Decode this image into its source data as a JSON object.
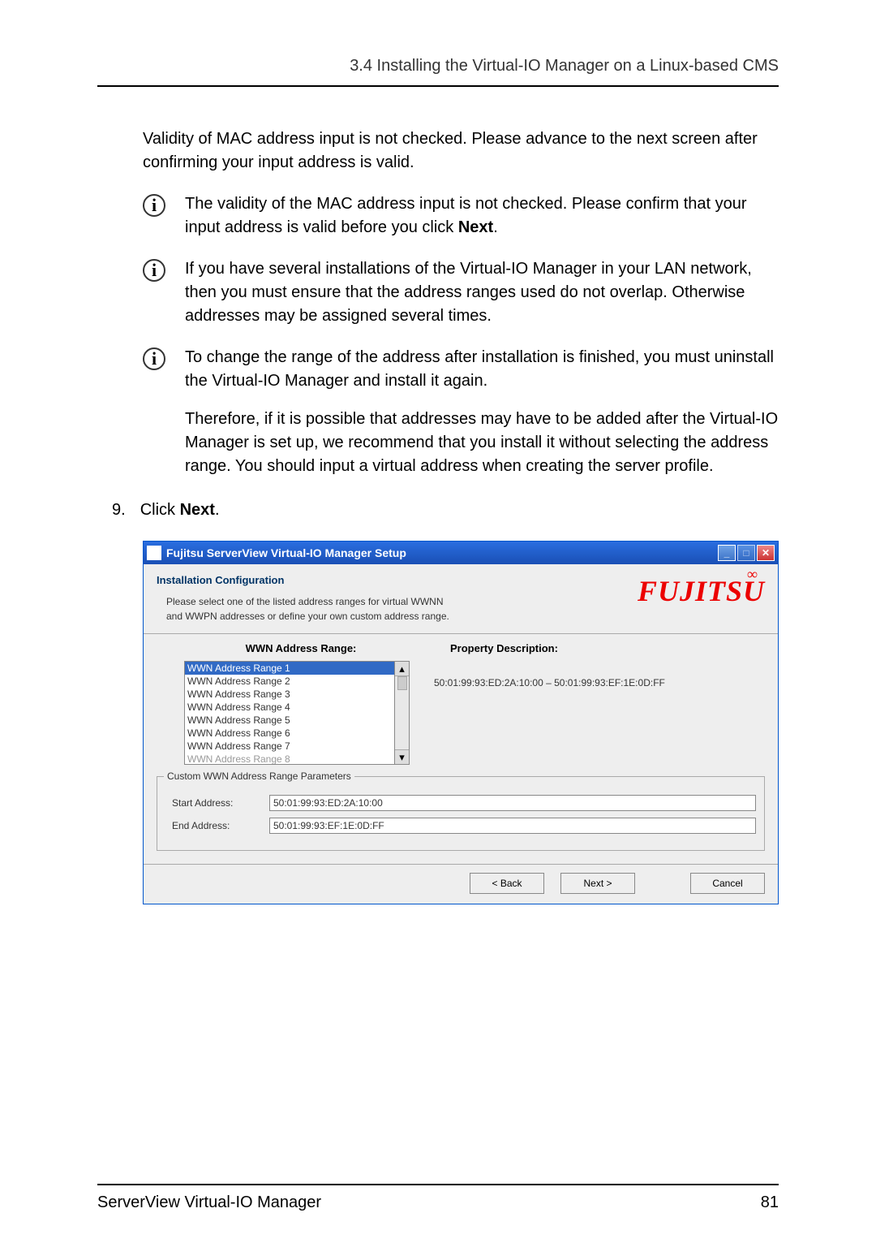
{
  "header": {
    "section": "3.4 Installing the Virtual-IO Manager on a Linux-based CMS"
  },
  "intro": "Validity of MAC address input is not checked. Please advance to the next screen after confirming your input address is valid.",
  "note1": "The validity of the MAC address input is not checked. Please confirm that your input address is valid before you click ",
  "note1_bold": "Next",
  "note1_tail": ".",
  "note2": "If you have several installations of the Virtual-IO Manager in your LAN network, then you must ensure that the address ranges used do not overlap. Otherwise addresses may be assigned several times.",
  "note3a": "To change the range of the address after installation is finished, you must uninstall the Virtual-IO Manager and install it again.",
  "note3b": "Therefore, if it is possible that addresses may have to be added after the Virtual-IO Manager is set up, we recommend that you install it without selecting the address range. You should input a virtual address when creating the server profile.",
  "step9_num": "9.",
  "step9_pre": "Click ",
  "step9_bold": "Next",
  "step9_tail": ".",
  "dialog": {
    "title": "Fujitsu ServerView Virtual-IO Manager Setup",
    "logo": "FUJITSU",
    "config_title": "Installation Configuration",
    "config_desc1": "Please select one of the listed address ranges for virtual WWNN",
    "config_desc2": "and WWPN addresses or define your own custom address range.",
    "left_header": "WWN Address Range:",
    "right_header": "Property Description:",
    "items": [
      "WWN Address Range 1",
      "WWN Address Range 2",
      "WWN Address Range 3",
      "WWN Address Range 4",
      "WWN Address Range 5",
      "WWN Address Range 6",
      "WWN Address Range 7",
      "WWN Address Range 8"
    ],
    "prop_value": "50:01:99:93:ED:2A:10:00 – 50:01:99:93:EF:1E:0D:FF",
    "fieldset_legend": "Custom WWN Address Range Parameters",
    "start_label": "Start Address:",
    "start_value": "50:01:99:93:ED:2A:10:00",
    "end_label": "End Address:",
    "end_value": "50:01:99:93:EF:1E:0D:FF",
    "back": "< Back",
    "next": "Next >",
    "cancel": "Cancel"
  },
  "footer": {
    "left": "ServerView Virtual-IO Manager",
    "right": "81"
  }
}
